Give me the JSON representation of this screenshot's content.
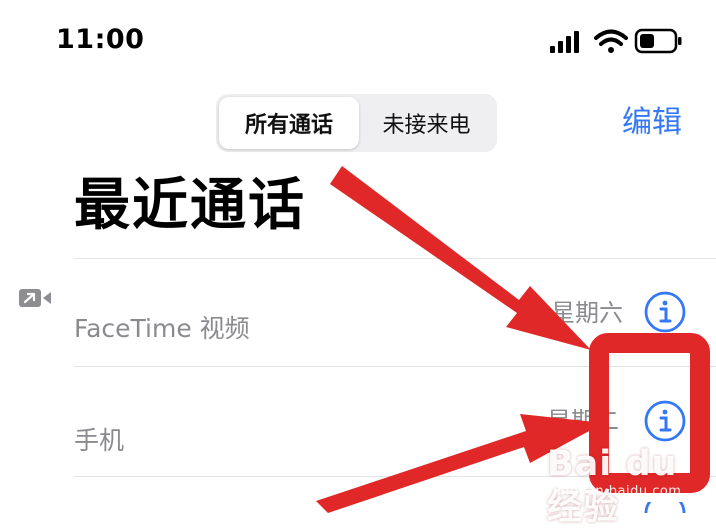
{
  "status_bar": {
    "time": "11:00",
    "icons": [
      "signal-icon",
      "wifi-icon",
      "battery-icon"
    ]
  },
  "segmented": {
    "selected_label": "所有通话",
    "other_label": "未接来电"
  },
  "header": {
    "edit_label": "编辑",
    "title": "最近通话"
  },
  "calls": [
    {
      "label": "FaceTime 视频",
      "day": "星期六",
      "icon": "facetime-video-icon"
    },
    {
      "label": "手机",
      "day": "星期二"
    }
  ],
  "colors": {
    "accent": "#3478f6",
    "secondary_text": "#8b8b8f",
    "annotation_red": "#e02828"
  },
  "watermark": {
    "logo": "Bai du 经验",
    "url": "jingyan.baidu.com"
  }
}
